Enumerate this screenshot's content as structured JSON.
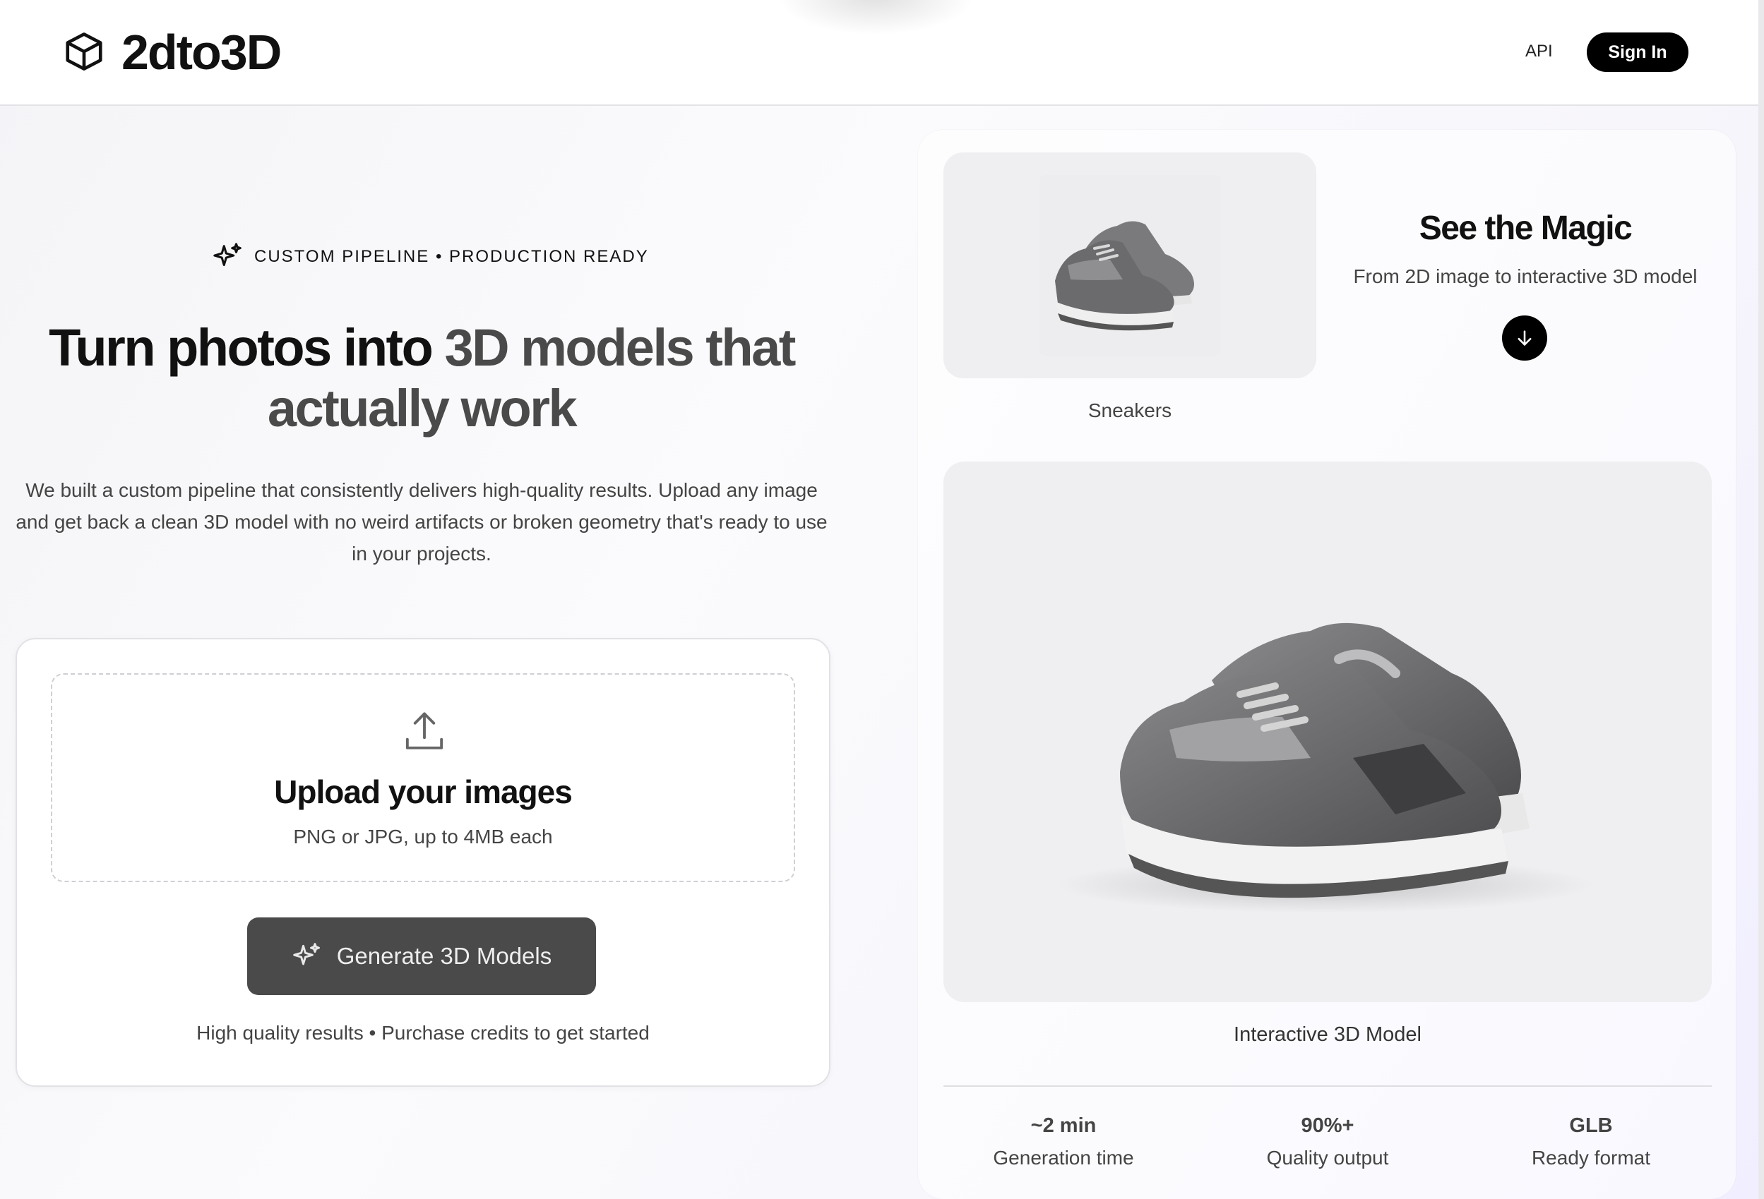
{
  "header": {
    "brand": "2dto3D",
    "nav_api": "API",
    "signin_label": "Sign In"
  },
  "hero": {
    "tag": "CUSTOM PIPELINE • PRODUCTION READY",
    "headline_part1": "Turn photos into ",
    "headline_part2": "3D models that actually work",
    "description": "We built a custom pipeline that consistently delivers high-quality results. Upload any image and get back a clean 3D model with no weird artifacts or broken geometry that's ready to use in your projects."
  },
  "upload": {
    "title": "Upload your images",
    "subtitle": "PNG or JPG, up to 4MB each",
    "button_label": "Generate 3D Models",
    "note": "High quality results • Purchase credits to get started"
  },
  "demo": {
    "source_caption": "Sneakers",
    "title": "See the Magic",
    "subtitle": "From 2D image to interactive 3D model",
    "model_caption": "Interactive 3D Model",
    "stats": [
      {
        "value": "~2 min",
        "label": "Generation time"
      },
      {
        "value": "90%+",
        "label": "Quality output"
      },
      {
        "value": "GLB",
        "label": "Ready format"
      }
    ]
  },
  "colors": {
    "primary_button": "#000000",
    "generate_button": "#4a4a4a",
    "accent_text": "#4a4a4a"
  },
  "icons": [
    "cube-icon",
    "sparkles-icon",
    "upload-icon",
    "arrow-down-icon"
  ]
}
